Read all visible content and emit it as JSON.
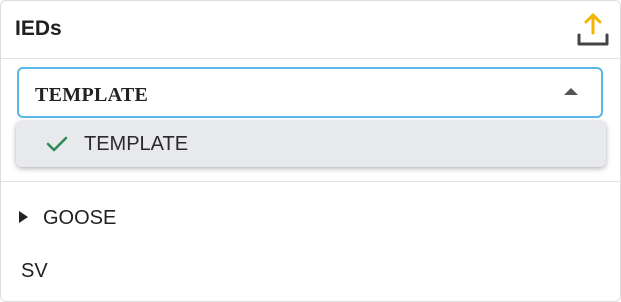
{
  "panel": {
    "title": "IEDs",
    "upload_icon": "upload-icon",
    "accent_color": "#f5b400",
    "select_border_color": "#5ab8e8"
  },
  "selector": {
    "value": "TEMPLATE",
    "caret_icon": "caret-up-icon",
    "options": [
      {
        "label": "TEMPLATE",
        "selected": true,
        "icon": "check-icon",
        "icon_color": "#2e8b57"
      }
    ]
  },
  "tree": {
    "items": [
      {
        "label": "GOOSE",
        "icon": "triangle-right-icon",
        "expandable": true
      },
      {
        "label": "SV",
        "expandable": false
      }
    ]
  }
}
